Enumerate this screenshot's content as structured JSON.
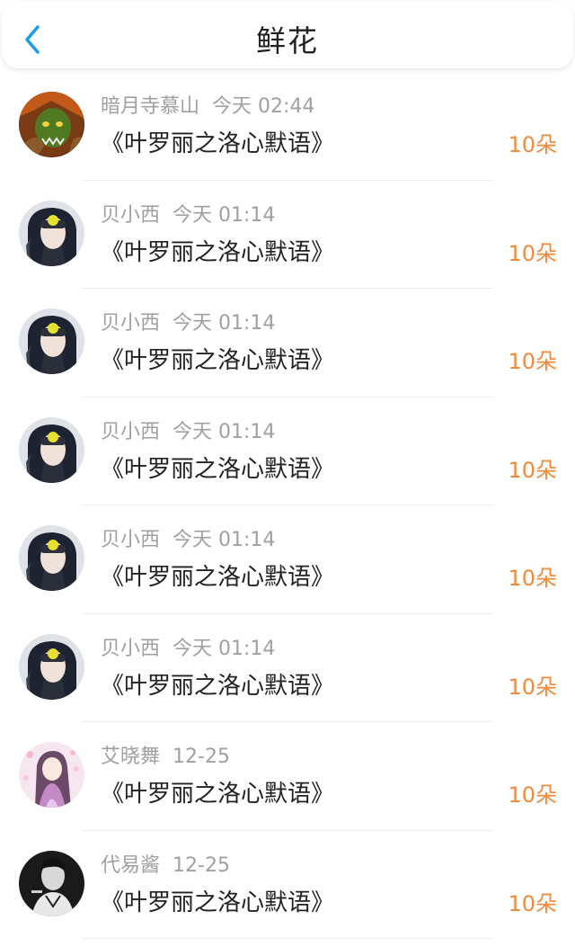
{
  "header": {
    "title": "鲜花",
    "back_icon": "chevron-left-icon",
    "accent_color": "#1a9bf0"
  },
  "count_color": "#f08a3c",
  "items": [
    {
      "user": "暗月寺慕山",
      "time": "今天 02:44",
      "book": "《叶罗丽之洛心默语》",
      "count": "10朵",
      "avatar": "orc"
    },
    {
      "user": "贝小西",
      "time": "今天 01:14",
      "book": "《叶罗丽之洛心默语》",
      "count": "10朵",
      "avatar": "masked"
    },
    {
      "user": "贝小西",
      "time": "今天 01:14",
      "book": "《叶罗丽之洛心默语》",
      "count": "10朵",
      "avatar": "masked"
    },
    {
      "user": "贝小西",
      "time": "今天 01:14",
      "book": "《叶罗丽之洛心默语》",
      "count": "10朵",
      "avatar": "masked"
    },
    {
      "user": "贝小西",
      "time": "今天 01:14",
      "book": "《叶罗丽之洛心默语》",
      "count": "10朵",
      "avatar": "masked"
    },
    {
      "user": "贝小西",
      "time": "今天 01:14",
      "book": "《叶罗丽之洛心默语》",
      "count": "10朵",
      "avatar": "masked"
    },
    {
      "user": "艾晓舞",
      "time": "12-25",
      "book": "《叶罗丽之洛心默语》",
      "count": "10朵",
      "avatar": "anime-girl"
    },
    {
      "user": "代易酱",
      "time": "12-25",
      "book": "《叶罗丽之洛心默语》",
      "count": "10朵",
      "avatar": "bw-portrait"
    }
  ]
}
